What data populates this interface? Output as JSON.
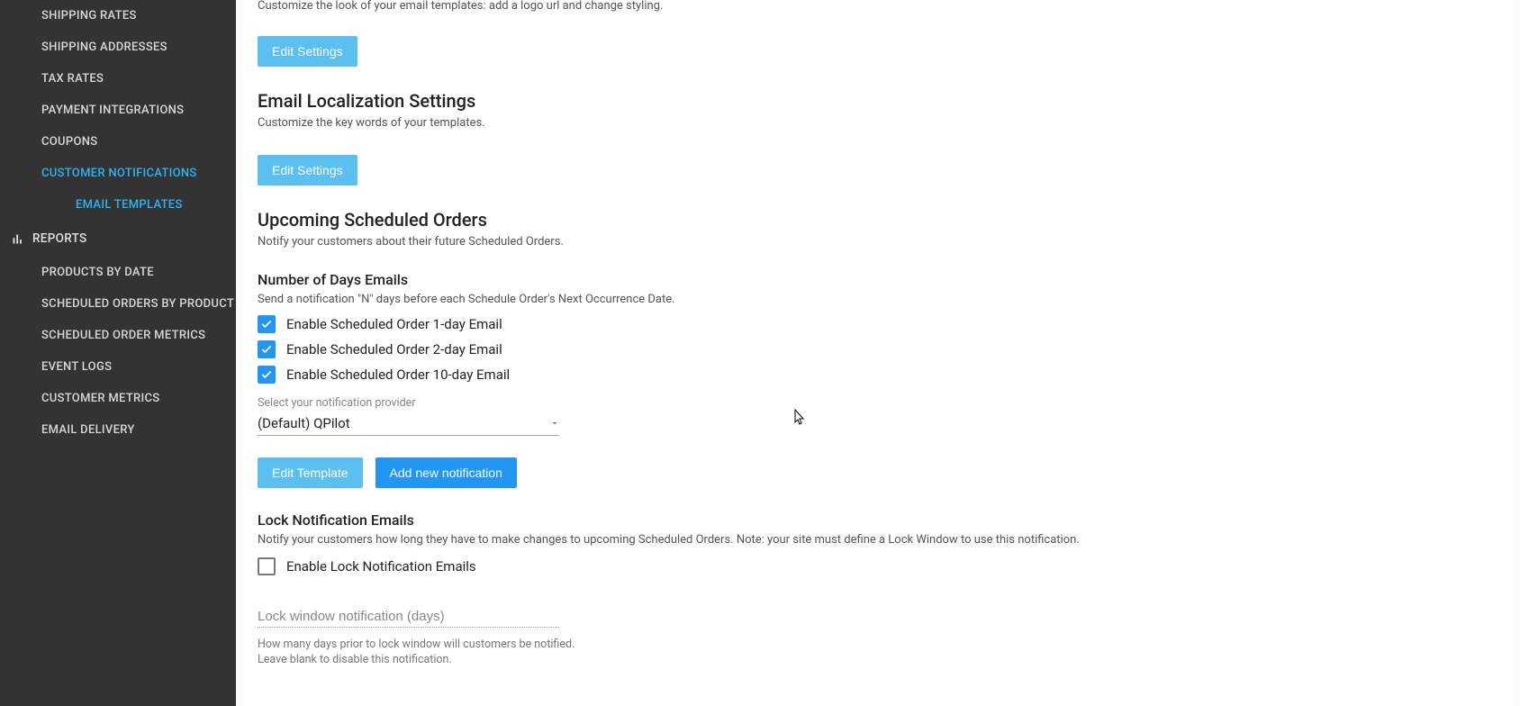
{
  "sidebar": {
    "items": [
      {
        "label": "SHIPPING RATES"
      },
      {
        "label": "SHIPPING ADDRESSES"
      },
      {
        "label": "TAX RATES"
      },
      {
        "label": "PAYMENT INTEGRATIONS"
      },
      {
        "label": "COUPONS"
      },
      {
        "label": "CUSTOMER NOTIFICATIONS",
        "active": true
      },
      {
        "label": "EMAIL TEMPLATES",
        "active": true,
        "sub": true
      }
    ],
    "reports_header": "REPORTS",
    "reports": [
      {
        "label": "PRODUCTS BY DATE"
      },
      {
        "label": "SCHEDULED ORDERS BY PRODUCT"
      },
      {
        "label": "SCHEDULED ORDER METRICS"
      },
      {
        "label": "EVENT LOGS"
      },
      {
        "label": "CUSTOMER METRICS"
      },
      {
        "label": "EMAIL DELIVERY"
      }
    ]
  },
  "main": {
    "partial": {
      "desc": "Customize the look of your email templates: add a logo url and change styling.",
      "button": "Edit Settings"
    },
    "localization": {
      "title": "Email Localization Settings",
      "desc": "Customize the key words of your templates.",
      "button": "Edit Settings"
    },
    "upcoming": {
      "title": "Upcoming Scheduled Orders",
      "desc": "Notify your customers about their future Scheduled Orders."
    },
    "days": {
      "title": "Number of Days Emails",
      "desc": "Send a notification \"N\" days before each Schedule Order's Next Occurrence Date.",
      "checks": [
        {
          "label": "Enable Scheduled Order 1-day Email",
          "checked": true
        },
        {
          "label": "Enable Scheduled Order 2-day Email",
          "checked": true
        },
        {
          "label": "Enable Scheduled Order 10-day Email",
          "checked": true
        }
      ],
      "provider_label": "Select your notification provider",
      "provider_value": "(Default) QPilot",
      "edit_template": "Edit Template",
      "add_notification": "Add new notification"
    },
    "lock": {
      "title": "Lock Notification Emails",
      "desc": "Notify your customers how long they have to make changes to upcoming Scheduled Orders. Note: your site must define a Lock Window to use this notification.",
      "check_label": "Enable Lock Notification Emails",
      "input_placeholder": "Lock window notification (days)",
      "helper1": "How many days prior to lock window will customers be notified.",
      "helper2": "Leave blank to disable this notification."
    }
  }
}
